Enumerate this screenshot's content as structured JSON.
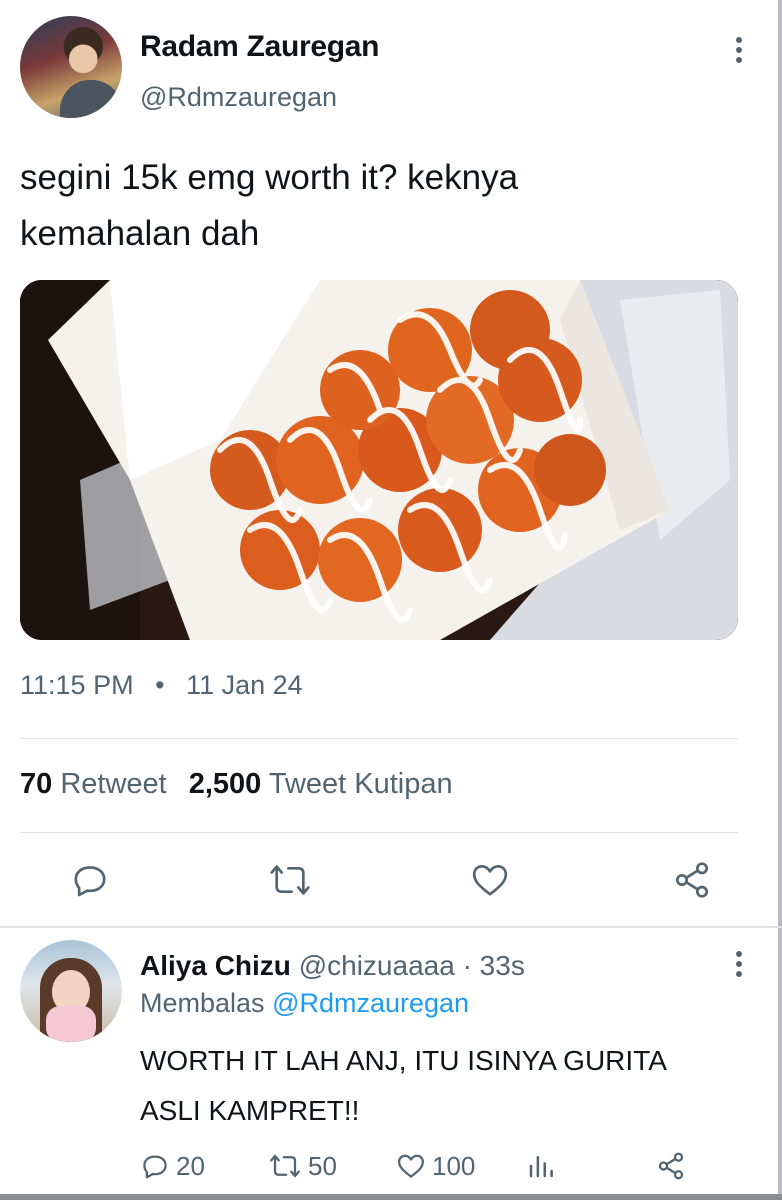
{
  "tweet": {
    "author_name": "Radam Zauregan",
    "author_handle": "@Rdmzauregan",
    "text_line1": "segini 15k emg worth it? keknya",
    "text_line2": "kemahalan dah",
    "time": "11:15 PM",
    "separator": "•",
    "date": "11 Jan 24",
    "retweet_count": "70",
    "retweet_label": "Retweet",
    "quote_count": "2,500",
    "quote_label": "Tweet Kutipan"
  },
  "reply": {
    "author_name": "Aliya Chizu",
    "author_handle": "@chizuaaaa",
    "time_sep": "·",
    "time": "33s",
    "context_label": "Membalas",
    "context_mention": "@Rdmzauregan",
    "text_line1": "WORTH IT LAH ANJ, ITU ISINYA GURITA",
    "text_line2": "ASLI KAMPRET!!",
    "replies": "20",
    "retweets": "50",
    "likes": "100"
  },
  "colors": {
    "primary_text": "#0f1419",
    "secondary_text": "#536471",
    "link": "#1d9bf0",
    "divider": "#dfe3e6"
  },
  "icons": [
    "more-vertical-icon",
    "reply-icon",
    "retweet-icon",
    "like-icon",
    "share-icon",
    "analytics-icon"
  ]
}
